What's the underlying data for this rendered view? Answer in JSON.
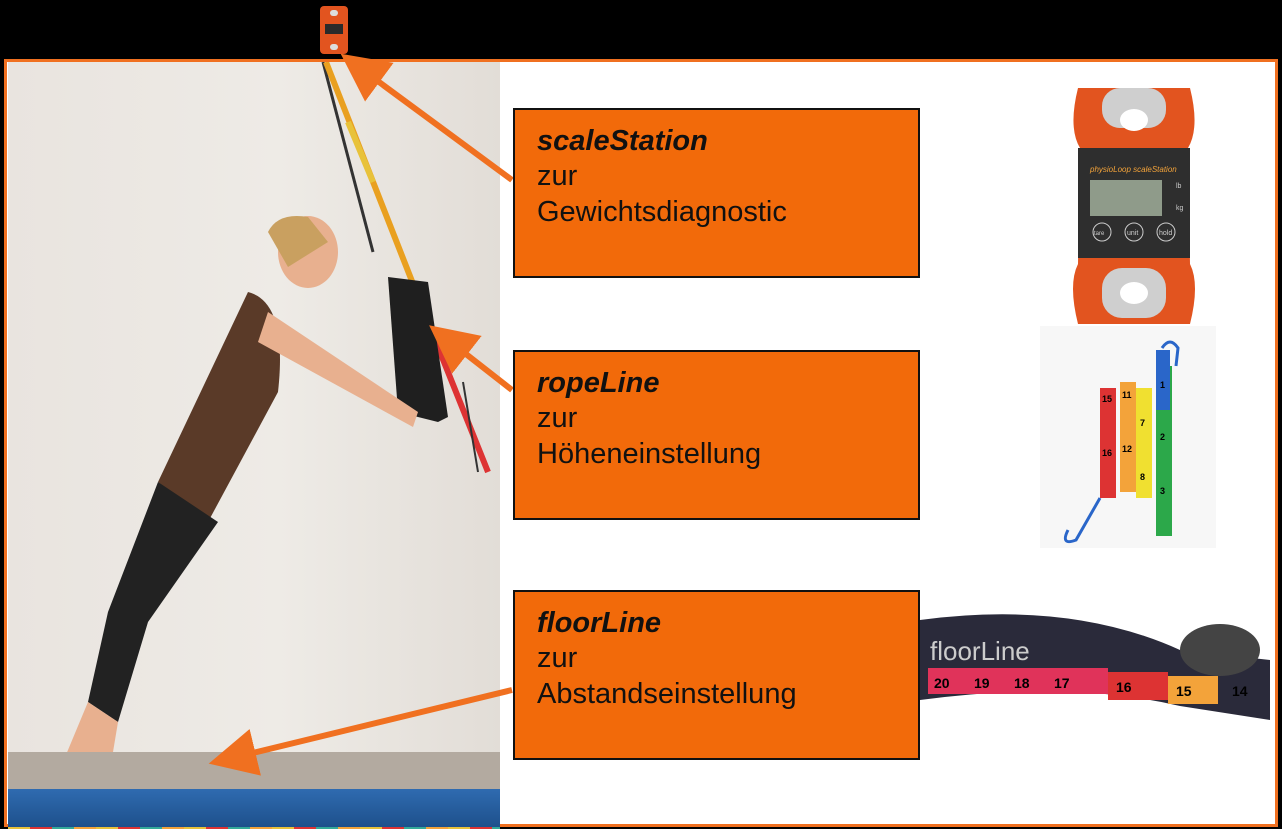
{
  "labels": [
    {
      "name": "scaleStation",
      "line1": "zur",
      "line2": "Gewichtsdiagnostic"
    },
    {
      "name": "ropeLine",
      "line1": "zur",
      "line2": "Höheneinstellung"
    },
    {
      "name": "floorLine",
      "line1": "zur",
      "line2": "Abstandseinstellung"
    }
  ],
  "scale_device": {
    "brand": "physioLoop scaleStation",
    "buttons": [
      "tare",
      "unit",
      "hold"
    ],
    "units": [
      "lb",
      "kg"
    ]
  },
  "rope_numbers": [
    "15",
    "16",
    "11",
    "12",
    "7",
    "8",
    "1",
    "2",
    "3"
  ],
  "floor_tape": {
    "logo": "floorLine",
    "numbers": [
      "20",
      "19",
      "18",
      "17",
      "16",
      "15",
      "14"
    ]
  },
  "colors": {
    "accent": "#f26a0a",
    "frame": "#f07020",
    "background": "#000000"
  }
}
